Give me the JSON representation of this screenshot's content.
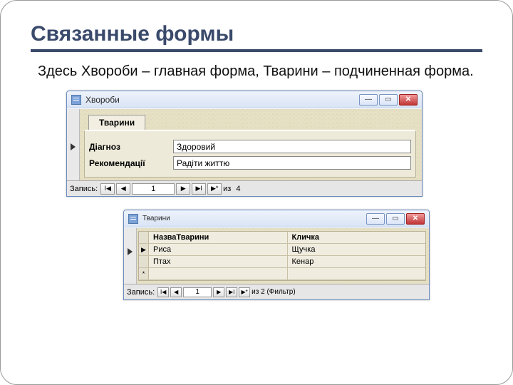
{
  "slide": {
    "title": "Связанные формы",
    "desc": "Здесь Хвороби – главная форма, Тварини – подчиненная форма."
  },
  "win1": {
    "title": "Хвороби",
    "tab": "Тварини",
    "fields": {
      "diag_label": "Діагноз",
      "diag_value": "Здоровий",
      "rec_label": "Рекомендації",
      "rec_value": "Радіти життю"
    },
    "nav": {
      "label": "Запись:",
      "first": "I◀",
      "prev": "◀",
      "num": "1",
      "next": "▶",
      "last": "▶I",
      "new": "▶*",
      "count_prefix": "из",
      "count": "4"
    }
  },
  "win2": {
    "title": "Тварини",
    "headers": {
      "c1": "НазваТварини",
      "c2": "Кличка"
    },
    "rows": [
      {
        "c1": "Риса",
        "c2": "Щучка"
      },
      {
        "c1": "Птах",
        "c2": "Кенар"
      }
    ],
    "newrow_marker": "*",
    "nav": {
      "label": "Запись:",
      "first": "I◀",
      "prev": "◀",
      "num": "1",
      "next": "▶",
      "last": "▶I",
      "new": "▶*",
      "count_text": "из 2 (Фильтр)"
    }
  },
  "winbtns": {
    "min": "—",
    "max": "▭",
    "close": "✕"
  }
}
